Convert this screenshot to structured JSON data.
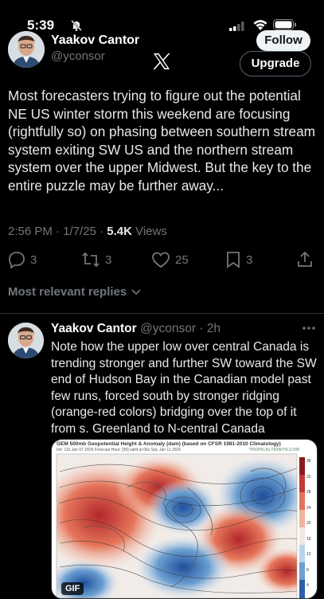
{
  "status_bar": {
    "time": "5:39"
  },
  "post": {
    "author_name": "Yaakov Cantor",
    "author_handle": "@yconsor",
    "follow_label": "Follow",
    "upgrade_label": "Upgrade",
    "text": "Most forecasters trying to figure out the potential NE US winter storm this weekend are focusing (rightfully so) on phasing between southern stream system exiting SW US and the northern stream system over the upper Midwest.  But the key to the entire puzzle may be further away...",
    "timestamp": "2:56 PM · 1/7/25 · ",
    "views_count": "5.4K",
    "views_label": " Views",
    "replies": "3",
    "reposts": "3",
    "likes": "25",
    "bookmarks": "3"
  },
  "sort": {
    "label": "Most relevant replies"
  },
  "reply": {
    "author_name": "Yaakov Cantor",
    "author_handle": "@yconsor",
    "time": "2h",
    "text": "Note how the upper low over central Canada is trending stronger and further SW toward the SW end of Hudson Bay in the Canadian model past few runs, forced south by stronger ridging (orange-red colors) bridging over the top of it from s. Greenland to N-central Canada",
    "media": {
      "title": "GEM 500mb Geopotential Height & Anomaly (dam) (based on CFSR 1981-2010 Climatology)",
      "subtitle": "Init: 12z Jan 07 2025   Forecast Hour: [90]   valid at 06z Sat, Jan 11 2025",
      "brand": "TROPICALTIDBITS.COM",
      "badge": "GIF",
      "colorbar_labels": [
        "36",
        "32",
        "28",
        "24",
        "20",
        "16",
        "12",
        "8",
        "4"
      ]
    }
  },
  "colors": {
    "background": "#000000",
    "text": "#e7e9ea",
    "muted": "#71767b",
    "divider": "#2f3336"
  },
  "icons": [
    "bell-slash-icon",
    "signal-icon",
    "wifi-icon",
    "battery-icon",
    "x-logo-icon",
    "reply-icon",
    "repost-icon",
    "like-icon",
    "bookmark-icon",
    "share-icon",
    "chevron-down-icon",
    "more-icon"
  ]
}
